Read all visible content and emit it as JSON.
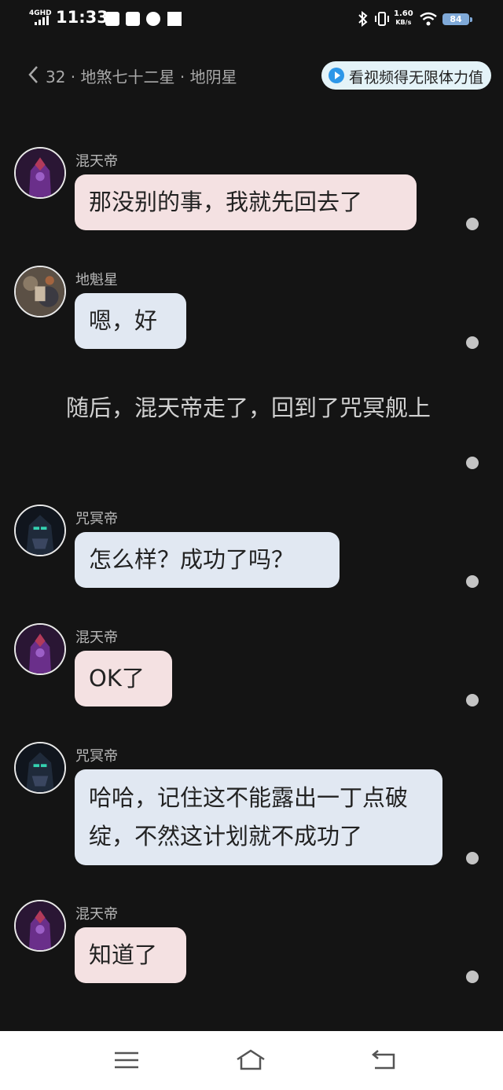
{
  "status_bar": {
    "network": "4GHD",
    "time": "11:33",
    "speed_value": "1.60",
    "speed_unit": "KB/s",
    "battery": "84"
  },
  "header": {
    "chapter_title": "32 · 地煞七十二星 · 地阴星",
    "ad_button_label": "看视频得无限体力值"
  },
  "messages": [
    {
      "name": "混天帝",
      "text": "那没别的事，我就先回去了",
      "color": "pink"
    },
    {
      "name": "地魁星",
      "text": "嗯，好",
      "color": "blue"
    },
    {
      "narration": "随后，混天帝走了，回到了咒冥舰上"
    },
    {
      "name": "咒冥帝",
      "text": "怎么样？成功了吗？",
      "color": "blue"
    },
    {
      "name": "混天帝",
      "text": "OK了",
      "color": "pink"
    },
    {
      "name": "咒冥帝",
      "text": "哈哈，记住这不能露出一丁点破绽，不然这计划就不成功了",
      "color": "blue"
    },
    {
      "name": "混天帝",
      "text": "知道了",
      "color": "pink"
    }
  ],
  "colors": {
    "background": "#141414",
    "pink_bubble": "#f4e1e2",
    "blue_bubble": "#e1e8f2",
    "ad_button": "#e4f3f8",
    "ad_play_icon": "#2d97e8"
  }
}
